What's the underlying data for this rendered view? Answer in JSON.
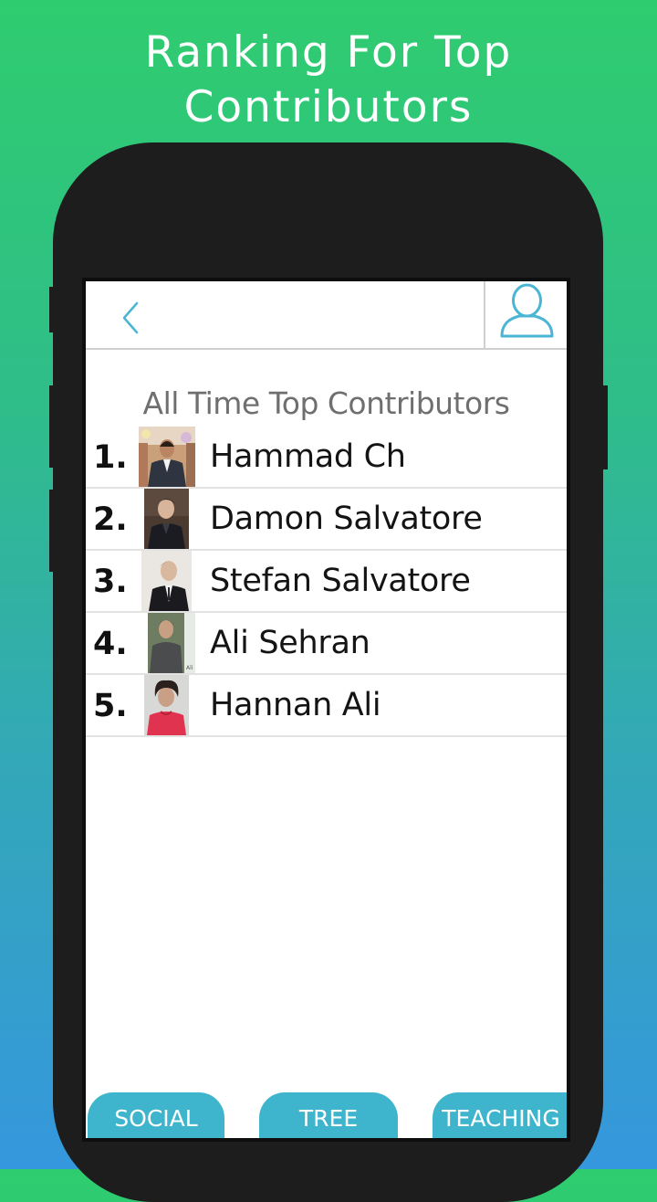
{
  "banner": {
    "title": "Ranking For Top Contributors"
  },
  "header": {
    "back_icon": "chevron-left-icon",
    "profile_icon": "user-profile-icon",
    "accent_color": "#4ab6d3"
  },
  "main": {
    "heading": "All Time Top Contributors",
    "contributors": [
      {
        "rank": "1.",
        "name": "Hammad Ch"
      },
      {
        "rank": "2.",
        "name": "Damon Salvatore"
      },
      {
        "rank": "3.",
        "name": "Stefan Salvatore"
      },
      {
        "rank": "4.",
        "name": "Ali Sehran"
      },
      {
        "rank": "5.",
        "name": "Hannan Ali"
      }
    ]
  },
  "tabs": [
    {
      "label": "SOCIAL"
    },
    {
      "label": "TREE"
    },
    {
      "label": "TEACHING"
    }
  ],
  "colors": {
    "tab_background": "#3eb5cc",
    "gradient_top": "#2fcc6f",
    "gradient_bottom": "#3597dd"
  }
}
